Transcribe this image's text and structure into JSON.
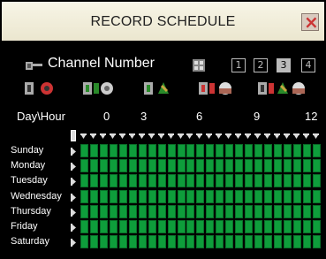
{
  "window": {
    "title": "RECORD SCHEDULE",
    "close_label": "×"
  },
  "channel": {
    "label": "Channel Number",
    "buttons": [
      "1",
      "2",
      "3",
      "4"
    ],
    "selected": "3"
  },
  "record_types": [
    "continuous",
    "motion",
    "alarm",
    "motion-alarm",
    "mixed"
  ],
  "hours": {
    "label": "Day\\Hour",
    "marks": [
      "0",
      "3",
      "6",
      "9",
      "12"
    ]
  },
  "days": [
    "Sunday",
    "Monday",
    "Tuesday",
    "Wednesday",
    "Thursday",
    "Friday",
    "Saturday"
  ],
  "colors": {
    "scheduled": "#0e9d3b",
    "title_bg": "#f7f5e6"
  }
}
